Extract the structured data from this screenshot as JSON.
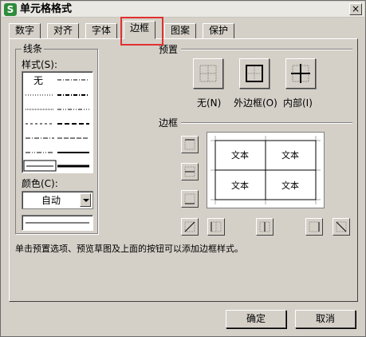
{
  "window": {
    "title": "单元格格式",
    "close_label": "×"
  },
  "app_icon": {
    "letter": "S",
    "color": "#2d8c3a"
  },
  "tabs": [
    {
      "label": "数字",
      "active": false
    },
    {
      "label": "对齐",
      "active": false
    },
    {
      "label": "字体",
      "active": false
    },
    {
      "label": "边框",
      "active": true
    },
    {
      "label": "图案",
      "active": false
    },
    {
      "label": "保护",
      "active": false
    }
  ],
  "highlight_color": "#e03030",
  "line": {
    "group_title": "线条",
    "style_label": "样式(S):",
    "none_label": "无",
    "color_label": "颜色(C):",
    "color_value": "自动"
  },
  "presets": {
    "title": "预置",
    "none_label": "无(N)",
    "outline_label": "外边框(O)",
    "inside_label": "内部(I)"
  },
  "border": {
    "title": "边框",
    "preview_cells": [
      "文本",
      "文本",
      "文本",
      "文本"
    ]
  },
  "hint": "单击预置选项、预览草图及上面的按钮可以添加边框样式。",
  "buttons": {
    "ok": "确定",
    "cancel": "取消"
  }
}
